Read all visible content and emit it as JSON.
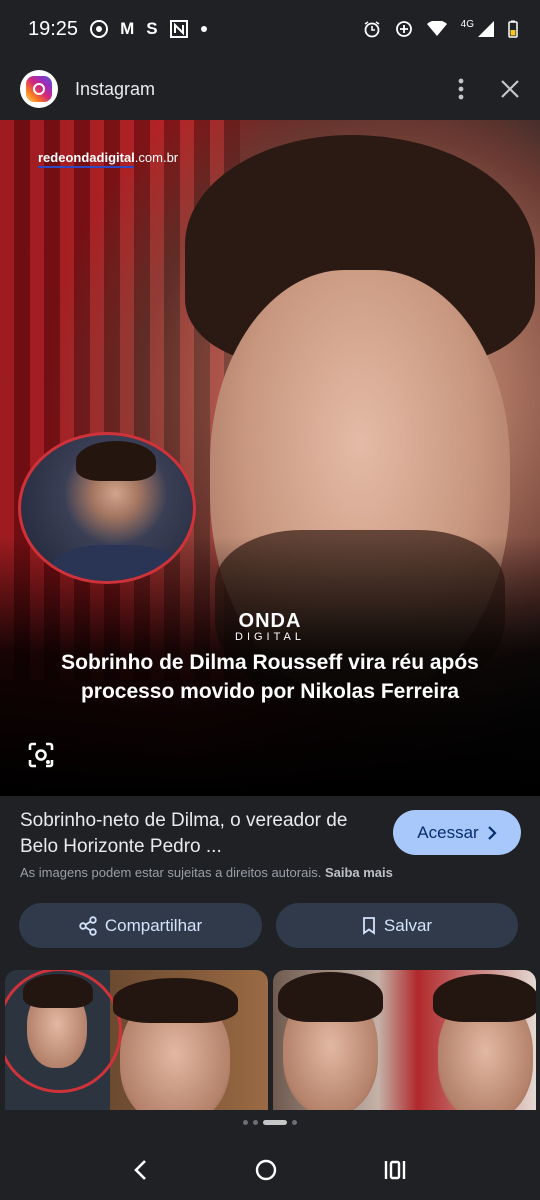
{
  "status_bar": {
    "time": "19:25",
    "left_icons": [
      "chrome-icon",
      "gmail-icon",
      "s-app-icon",
      "news-app-icon",
      "dot-icon"
    ],
    "letters": {
      "gmail": "M",
      "s_app": "S"
    },
    "network": "4G",
    "right_icons": [
      "alarm-icon",
      "data-saver-icon",
      "wifi-icon",
      "signal-icon",
      "battery-icon"
    ]
  },
  "header": {
    "title": "Instagram",
    "logo": "instagram-logo",
    "more_icon": "more-vert-icon",
    "close_icon": "close-icon"
  },
  "image": {
    "watermark_bold": "redeondadigital",
    "watermark_domain": ".com.br",
    "brand_main": "ONDA",
    "brand_sub": "DIGITAL",
    "headline": "Sobrinho de Dilma Rousseff vira réu após processo movido por Nikolas Ferreira",
    "lens_icon": "lens-icon"
  },
  "result": {
    "caption": "Sobrinho-neto de Dilma, o vereador de Belo Horizonte Pedro ...",
    "access_label": "Acessar",
    "copyright_text": "As imagens podem estar sujeitas a direitos autorais.",
    "learn_more": "Saiba mais"
  },
  "actions": {
    "share_label": "Compartilhar",
    "save_label": "Salvar"
  },
  "related": {
    "count": 2,
    "page_indicator": {
      "total_dots": 4,
      "active_index": 2
    }
  },
  "nav": {
    "back_icon": "back-icon",
    "home_icon": "home-icon",
    "recents_icon": "recents-icon"
  },
  "colors": {
    "background": "#1f2125",
    "access_button": "#a8c7fa",
    "action_button": "#303a4a",
    "accent_red": "#d0323a"
  }
}
